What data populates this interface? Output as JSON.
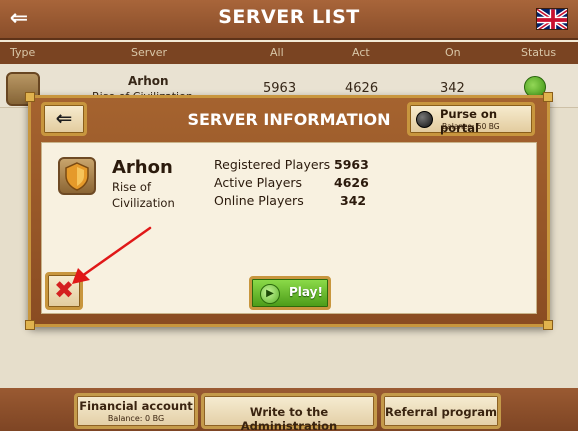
{
  "header": {
    "title": "SERVER LIST",
    "back_icon": "double-chevron-left-icon",
    "flag_icon": "uk-flag-icon"
  },
  "columns": [
    "Type",
    "Server",
    "All",
    "Act",
    "On",
    "Status"
  ],
  "server_row": {
    "name": "Arhon",
    "subtitle": "Rise of Civilization",
    "all": "5963",
    "act": "4626",
    "on": "342",
    "status_color": "#4ea91a"
  },
  "modal": {
    "title": "SERVER INFORMATION",
    "back_icon": "double-chevron-left-icon",
    "purse": {
      "label": "Purse on portal",
      "balance": "Balance: 50 BG"
    },
    "server": {
      "name": "Arhon",
      "subtitle": "Rise of Civilization"
    },
    "stats": [
      {
        "label": "Registered Players",
        "value": "5963"
      },
      {
        "label": "Active Players",
        "value": "4626"
      },
      {
        "label": "Online Players",
        "value": "342"
      }
    ],
    "close_icon": "close-x-icon",
    "play_label": "Play!"
  },
  "bottom": {
    "financial": {
      "label": "Financial account",
      "balance": "Balance: 0 BG"
    },
    "write_admin": "Write to the Administration",
    "referral": "Referral program"
  },
  "colors": {
    "header_brown": "#8a4e2a",
    "frame_gold": "#c8963e",
    "panel_cream": "#f8f1e0",
    "play_green": "#4a9a18",
    "close_red": "#d42020",
    "annotation_red": "#e01818"
  }
}
